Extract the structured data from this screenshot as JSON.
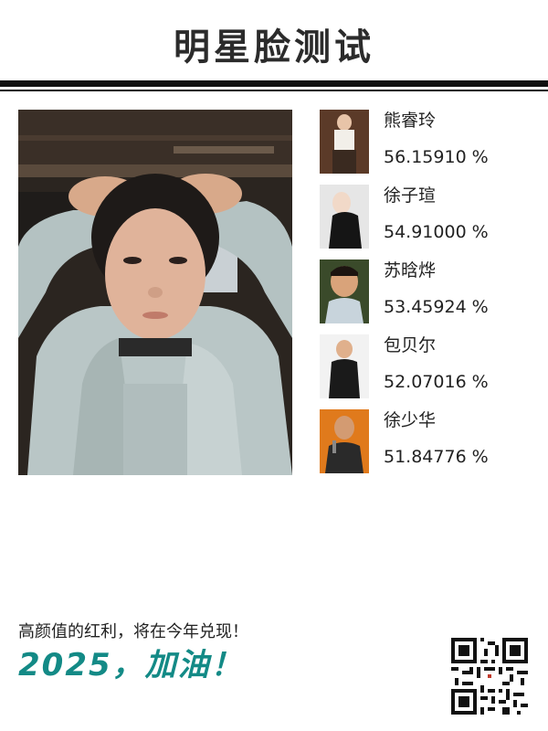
{
  "header": {
    "title": "明星脸测试"
  },
  "matches": [
    {
      "name": "熊睿玲",
      "score": "56.15910",
      "unit": "%",
      "colors": {
        "bg": "#5b3a28",
        "skin": "#e8c4a8",
        "cloth": "#f2efe9"
      }
    },
    {
      "name": "徐子瑄",
      "score": "54.91000",
      "unit": "%",
      "colors": {
        "bg": "#e6e6e6",
        "skin": "#f1d9c8",
        "cloth": "#151515"
      }
    },
    {
      "name": "苏晗烨",
      "score": "53.45924",
      "unit": "%",
      "colors": {
        "bg": "#3a4a2a",
        "skin": "#d9a37a",
        "cloth": "#c8d4dc"
      }
    },
    {
      "name": "包贝尔",
      "score": "52.07016",
      "unit": "%",
      "colors": {
        "bg": "#f2f2f2",
        "skin": "#e0b08c",
        "cloth": "#1a1a1a"
      }
    },
    {
      "name": "徐少华",
      "score": "51.84776",
      "unit": "%",
      "colors": {
        "bg": "#e07a1c",
        "skin": "#d39b72",
        "cloth": "#2a2a2a"
      }
    }
  ],
  "footer": {
    "slogan": "高颜值的红利，将在今年兑现！",
    "cheer": "2025，加油！",
    "accent_color": "#138a86"
  }
}
